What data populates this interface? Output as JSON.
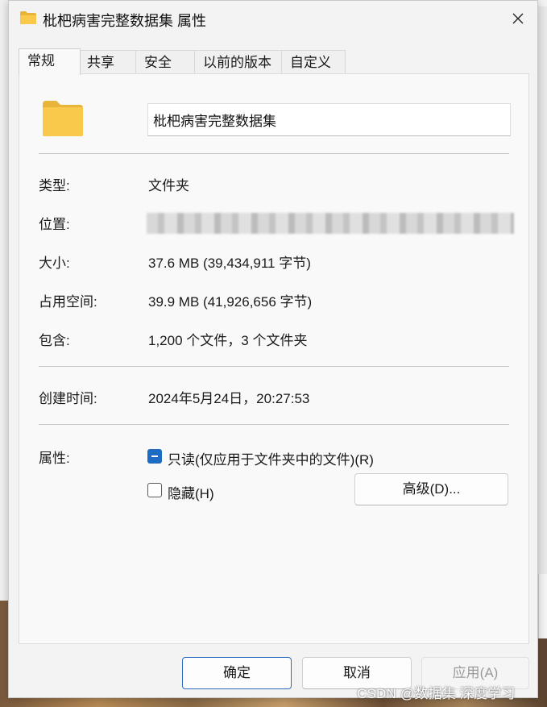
{
  "window": {
    "title": "枇杷病害完整数据集 属性"
  },
  "tabs": [
    "常规",
    "共享",
    "安全",
    "以前的版本",
    "自定义"
  ],
  "general": {
    "folder_name": "枇杷病害完整数据集",
    "type_label": "类型:",
    "type_value": "文件夹",
    "location_label": "位置:",
    "size_label": "大小:",
    "size_value": "37.6 MB (39,434,911 字节)",
    "disk_size_label": "占用空间:",
    "disk_size_value": "39.9 MB (41,926,656 字节)",
    "contains_label": "包含:",
    "contains_value": "1,200 个文件，3 个文件夹",
    "created_label": "创建时间:",
    "created_value": "2024年5月24日，20:27:53",
    "attributes_label": "属性:",
    "readonly_label": "只读(仅应用于文件夹中的文件)(R)",
    "hidden_label": "隐藏(H)",
    "advanced_button": "高级(D)..."
  },
  "footer": {
    "ok": "确定",
    "cancel": "取消",
    "apply": "应用(A)"
  },
  "watermark": "CSDN @数据集 深度学习",
  "colors": {
    "accent": "#1d6bc3",
    "folder": "#f8c94a"
  }
}
